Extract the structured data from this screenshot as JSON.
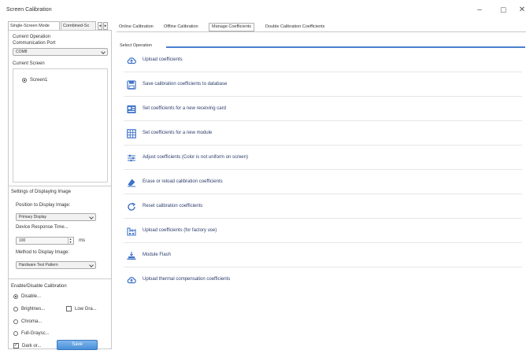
{
  "window": {
    "title": "Screen Calibration",
    "minimize": "–",
    "maximize": "☐",
    "close": "✕"
  },
  "left_tabs": {
    "single": "Single-Screen Mode",
    "combined": "Combined-Sc",
    "prev": "◂",
    "next": "▸"
  },
  "current_operation": {
    "title": "Current Operation",
    "port_label": "Communication Port",
    "port_value": "COM8",
    "screen_label": "Current Screen",
    "screen_item": "Screen1"
  },
  "display_settings": {
    "title": "Settings of Displaying Image",
    "position_label": "Position to Display Image:",
    "position_value": "Primary Display",
    "response_label": "Device Response Time...",
    "response_value": "100",
    "response_unit": "ms",
    "method_label": "Method to Display Image:",
    "method_value": "Hardware Test Pattern"
  },
  "calibration_toggle": {
    "title": "Enable/Disable Calibration",
    "disable": "Disable...",
    "brightness": "Brightnes...",
    "low_gray": "Low Gra...",
    "chroma": "Chroma...",
    "full_gray": "Full-Graysc...",
    "dark_or": "Dark or...",
    "save": "Save"
  },
  "right_tabs": {
    "online": "Online Calibration",
    "offline": "Offline Calibration",
    "manage": "Manage Coefficients",
    "double": "Double Calibration Coefficients"
  },
  "select_operation": "Select Operation",
  "operations": [
    {
      "label": "Upload coefficients",
      "icon": "cloud-upload-icon"
    },
    {
      "label": "Save calibration coefficients to database",
      "icon": "save-database-icon"
    },
    {
      "label": "Set coefficients for a new receiving card",
      "icon": "receiving-card-icon"
    },
    {
      "label": "Set coefficients for a new module",
      "icon": "module-icon"
    },
    {
      "label": "Adjust coefficients (Color is not uniform on screen)",
      "icon": "adjust-sliders-icon"
    },
    {
      "label": "Erase or reload calibration coefficients",
      "icon": "eraser-icon"
    },
    {
      "label": "Reset calibration coefficients",
      "icon": "reset-icon"
    },
    {
      "label": "Upload coefficients (for factory use)",
      "icon": "factory-upload-icon"
    },
    {
      "label": "Module Flash",
      "icon": "module-flash-icon"
    },
    {
      "label": "Upload thermal compensation coefficients",
      "icon": "thermal-upload-icon"
    }
  ],
  "colors": {
    "accent": "#3f73c8",
    "save_button": "#4a8fd8"
  }
}
